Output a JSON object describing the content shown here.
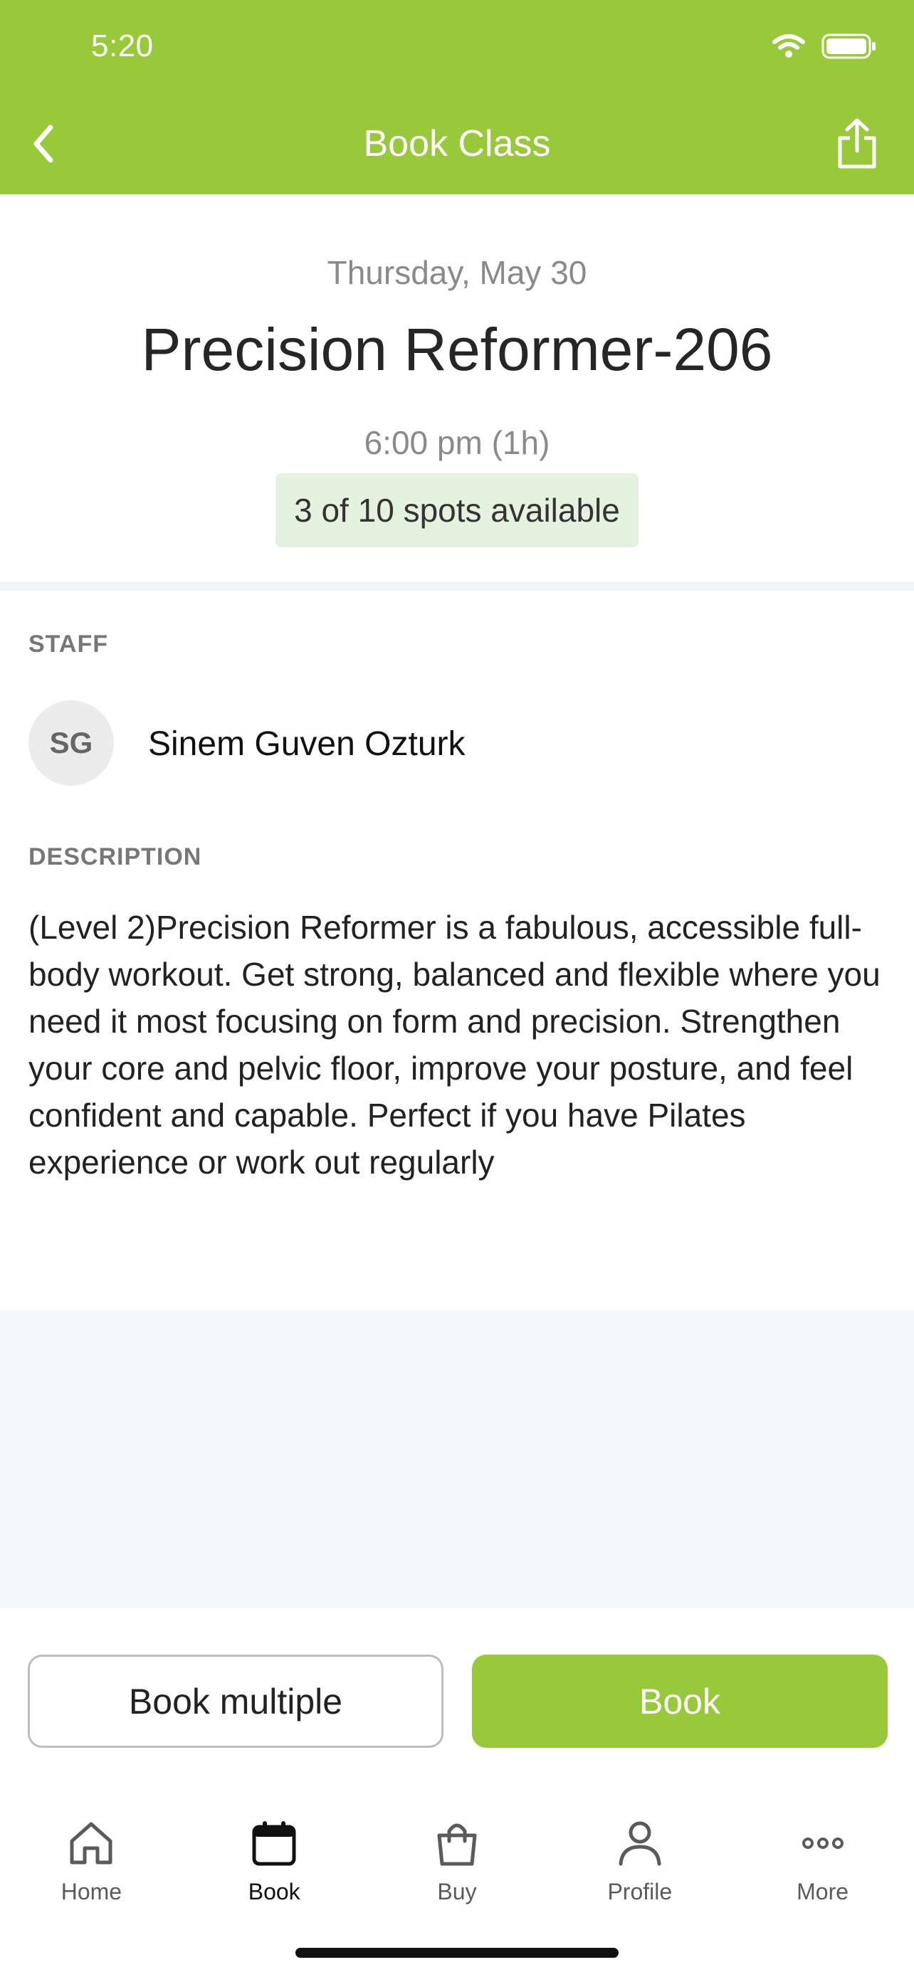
{
  "status_bar": {
    "time": "5:20",
    "icons": [
      "wifi-icon",
      "battery-icon"
    ]
  },
  "header": {
    "title": "Book Class",
    "back_icon": "chevron-left-icon",
    "share_icon": "share-icon",
    "background": "#97c93a"
  },
  "class_info": {
    "date": "Thursday, May 30",
    "title": "Precision Reformer-206",
    "time": "6:00 pm (1h)",
    "spots": "3 of 10 spots available"
  },
  "staff": {
    "label": "STAFF",
    "initials": "SG",
    "name": "Sinem Guven Ozturk"
  },
  "description": {
    "label": "DESCRIPTION",
    "text": "(Level 2)Precision Reformer is a fabulous, accessible full-body workout. Get strong, balanced and flexible where you need it most focusing on form and precision. Strengthen your core and pelvic floor, improve your posture, and feel confident and capable. Perfect if you have Pilates experience or work out regularly"
  },
  "actions": {
    "book_multiple": "Book multiple",
    "book": "Book",
    "accent": "#97c93a"
  },
  "tabbar": {
    "items": [
      {
        "label": "Home",
        "icon": "home-icon"
      },
      {
        "label": "Book",
        "icon": "calendar-icon",
        "active": true
      },
      {
        "label": "Buy",
        "icon": "shopping-bag-icon"
      },
      {
        "label": "Profile",
        "icon": "person-icon"
      },
      {
        "label": "More",
        "icon": "more-dots-icon"
      }
    ]
  }
}
